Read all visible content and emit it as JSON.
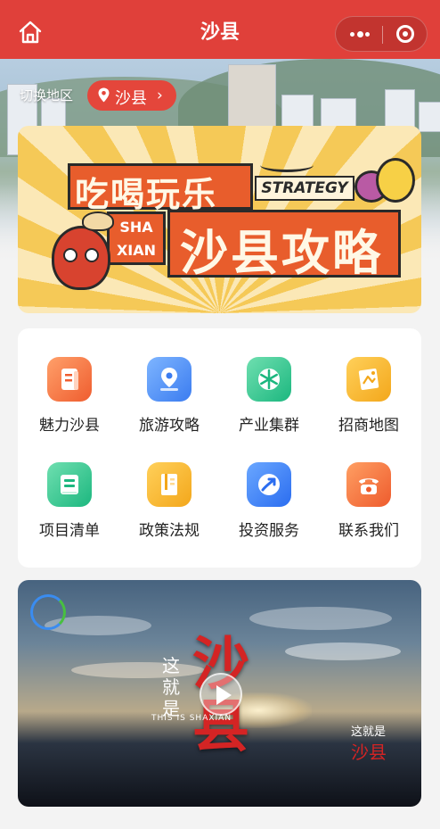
{
  "app": {
    "title": "沙县"
  },
  "nav": {
    "home_icon": "home-icon",
    "more_icon": "more-dots-icon",
    "close_icon": "close-target-icon"
  },
  "location": {
    "switch_label": "切换地区",
    "current_city": "沙县",
    "pin_icon": "location-pin-icon",
    "chevron": "›"
  },
  "banner": {
    "title_line1": "吃喝玩乐",
    "badge_en": "STRATEGY",
    "sx_badge": "SHA XIAN",
    "title_line2": "沙县攻略",
    "colors": {
      "accent": "#e85d2c",
      "background": "#f5c957"
    }
  },
  "menu": {
    "items": [
      {
        "label": "魅力沙县",
        "icon": "document-icon"
      },
      {
        "label": "旅游攻略",
        "icon": "map-pin-icon"
      },
      {
        "label": "产业集群",
        "icon": "snowflake-icon"
      },
      {
        "label": "招商地图",
        "icon": "map-icon"
      },
      {
        "label": "项目清单",
        "icon": "list-icon"
      },
      {
        "label": "政策法规",
        "icon": "book-icon"
      },
      {
        "label": "投资服务",
        "icon": "growth-arrow-icon"
      },
      {
        "label": "联系我们",
        "icon": "phone-icon"
      }
    ]
  },
  "video": {
    "main_title": [
      "沙",
      "县"
    ],
    "side_text": "这就是",
    "subtitle": "THIS IS SHAXIAN",
    "corner_red": "沙县",
    "corner_white": "这就是",
    "play_icon": "play-icon"
  },
  "colors": {
    "brand_red": "#e0403a",
    "page_bg": "#f3f3f3"
  }
}
